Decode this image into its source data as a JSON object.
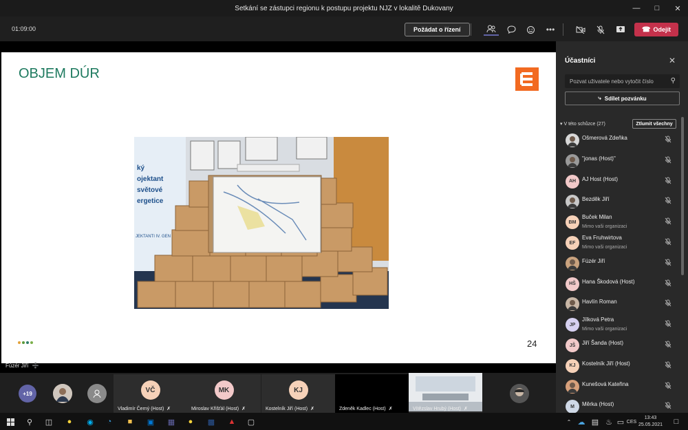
{
  "window": {
    "title": "Setkání se zástupci regionu k postupu projektu NJZ v lokalitě Dukovany"
  },
  "toolbar": {
    "timer": "01:09:00",
    "request_control": "Požádat o řízení",
    "leave": "Odejít"
  },
  "slide": {
    "title": "OBJEM DÚR",
    "page": "24",
    "photo_sign_lines": [
      "ký",
      "ojektant",
      "světové",
      "ergetice"
    ],
    "photo_footer": "JEKTANTI IV. GEN"
  },
  "speaker": {
    "name": "Fúzér Jiří"
  },
  "panel": {
    "title": "Účastníci",
    "invite_placeholder": "Pozvat uživatele nebo vytočit číslo",
    "share_invite": "Sdílet pozvánku",
    "section": "V této schůzce (27)",
    "mute_all": "Ztlumit všechny",
    "participants": [
      {
        "initials": "",
        "name": "Ošmerová Zdeňka",
        "sub": "",
        "color": "#d8d8d8"
      },
      {
        "initials": "",
        "name": "\"jonas (Host)\"",
        "sub": "",
        "color": "#9a9a9a"
      },
      {
        "initials": "AH",
        "name": "AJ Host (Host)",
        "sub": "",
        "color": "#f2c9c9"
      },
      {
        "initials": "",
        "name": "Bezděk Jiří",
        "sub": "",
        "color": "#c8c8c8"
      },
      {
        "initials": "BM",
        "name": "Buček Milan",
        "sub": "Mimo vaši organizaci",
        "color": "#f6d1b8"
      },
      {
        "initials": "EF",
        "name": "Eva Fruhwirtova",
        "sub": "Mimo vaši organizaci",
        "color": "#f6d1b8"
      },
      {
        "initials": "",
        "name": "Fúzér Jiří",
        "sub": "",
        "color": "#c9a27e"
      },
      {
        "initials": "HŠ",
        "name": "Hana Škodová (Host)",
        "sub": "",
        "color": "#f2c9c9"
      },
      {
        "initials": "",
        "name": "Havlín Roman",
        "sub": "",
        "color": "#c8b6a6"
      },
      {
        "initials": "JP",
        "name": "Jílková Petra",
        "sub": "Mimo vaši organizaci",
        "color": "#d6d0f0"
      },
      {
        "initials": "JŠ",
        "name": "Jiří Šanda (Host)",
        "sub": "",
        "color": "#f2c9c9"
      },
      {
        "initials": "KJ",
        "name": "Kostelník Jiří (Host)",
        "sub": "",
        "color": "#f6d1b8"
      },
      {
        "initials": "",
        "name": "Kunešová Kateřina",
        "sub": "",
        "color": "#d7a07b"
      },
      {
        "initials": "M",
        "name": "Měrka (Host)",
        "sub": "",
        "color": "#cfd8e6"
      }
    ]
  },
  "strip": {
    "more_count": "+19",
    "tiles": [
      {
        "initials": "VČ",
        "label": "Vladimír Černý (Host)",
        "color": "#f6d1b8"
      },
      {
        "initials": "MK",
        "label": "Miroslav Křišťál (Host)",
        "color": "#f2c9c9"
      },
      {
        "initials": "KJ",
        "label": "Kostelník Jiří (Host)",
        "color": "#f6d1b8"
      },
      {
        "initials": "",
        "label": "Zdeněk Kadlec (Host)",
        "color": "#000"
      },
      {
        "initials": "",
        "label": "Vítězslav Hrubý (Host)",
        "color": "#ddd"
      }
    ]
  },
  "taskbar": {
    "lang": "CES",
    "time": "13:43",
    "date": "25.05.2021"
  },
  "colors": {
    "accent": "#6264a7",
    "leave": "#c4314b",
    "slide_title": "#1e7a5f",
    "logo": "#f26a21"
  }
}
